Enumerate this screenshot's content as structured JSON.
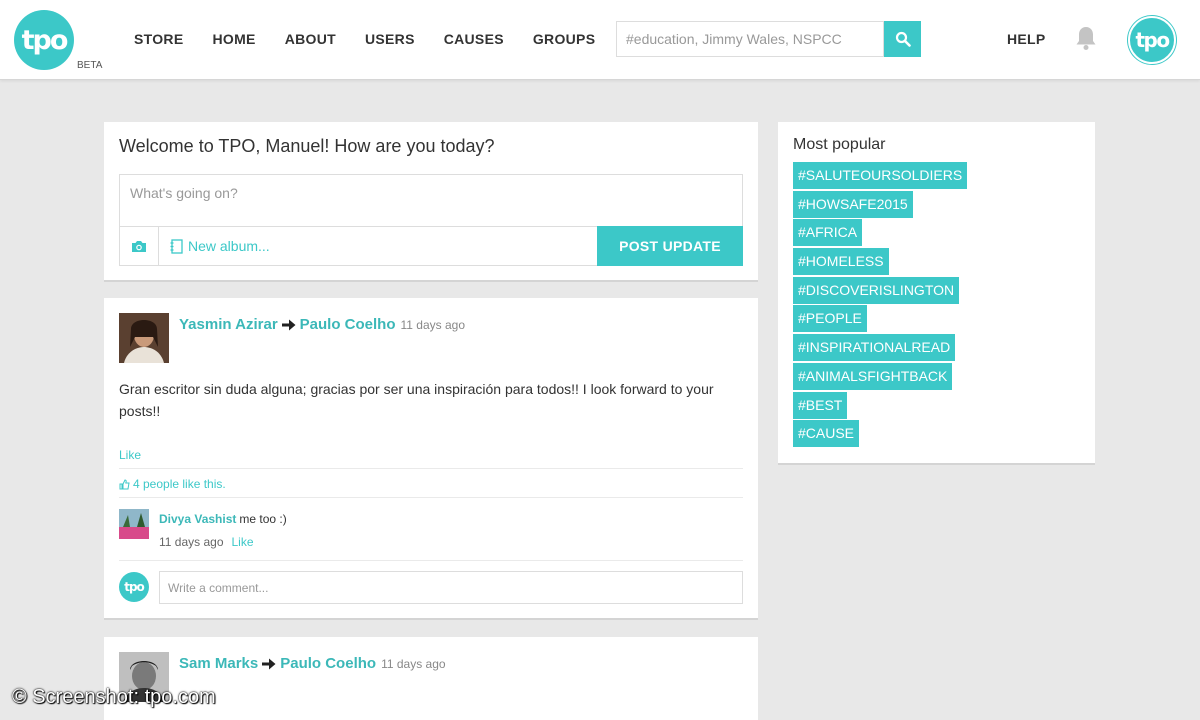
{
  "header": {
    "logo_text": "tpo",
    "beta_label": "BETA",
    "nav": [
      "STORE",
      "HOME",
      "ABOUT",
      "USERS",
      "CAUSES",
      "GROUPS"
    ],
    "search_placeholder": "#education, Jimmy Wales, NSPCC",
    "help_label": "HELP",
    "avatar_text": "tpo"
  },
  "composer": {
    "welcome": "Welcome to TPO, Manuel! How are you today?",
    "placeholder": "What's going on?",
    "new_album": "New album...",
    "post_button": "POST UPDATE"
  },
  "posts": [
    {
      "author": "Yasmin Azirar",
      "target": "Paulo Coelho",
      "time": "11 days ago",
      "body": "Gran escritor sin duda alguna; gracias por ser una inspiración para todos!! I look forward to your posts!!",
      "like_label": "Like",
      "likes_text": "4 people like this.",
      "comment": {
        "author": "Divya Vashist",
        "text": "me too :)",
        "time": "11 days ago",
        "like_label": "Like"
      },
      "comment_placeholder": "Write a comment...",
      "my_avatar": "tpo"
    },
    {
      "author": "Sam Marks",
      "target": "Paulo Coelho",
      "time": "11 days ago"
    }
  ],
  "sidebar": {
    "title": "Most popular",
    "tags": [
      "#SALUTEOURSOLDIERS",
      "#HOWSAFE2015",
      "#AFRICA",
      "#HOMELESS",
      "#DISCOVERISLINGTON",
      "#PEOPLE",
      "#INSPIRATIONALREAD",
      "#ANIMALSFIGHTBACK",
      "#BEST",
      "#CAUSE"
    ]
  },
  "watermark": "© Screenshot: tpo.com",
  "colors": {
    "accent": "#3cc8c8",
    "background": "#e8e8e8"
  },
  "icons": [
    "search-icon",
    "bell-icon",
    "camera-icon",
    "album-icon",
    "arrow-right-icon",
    "thumbs-up-icon"
  ]
}
